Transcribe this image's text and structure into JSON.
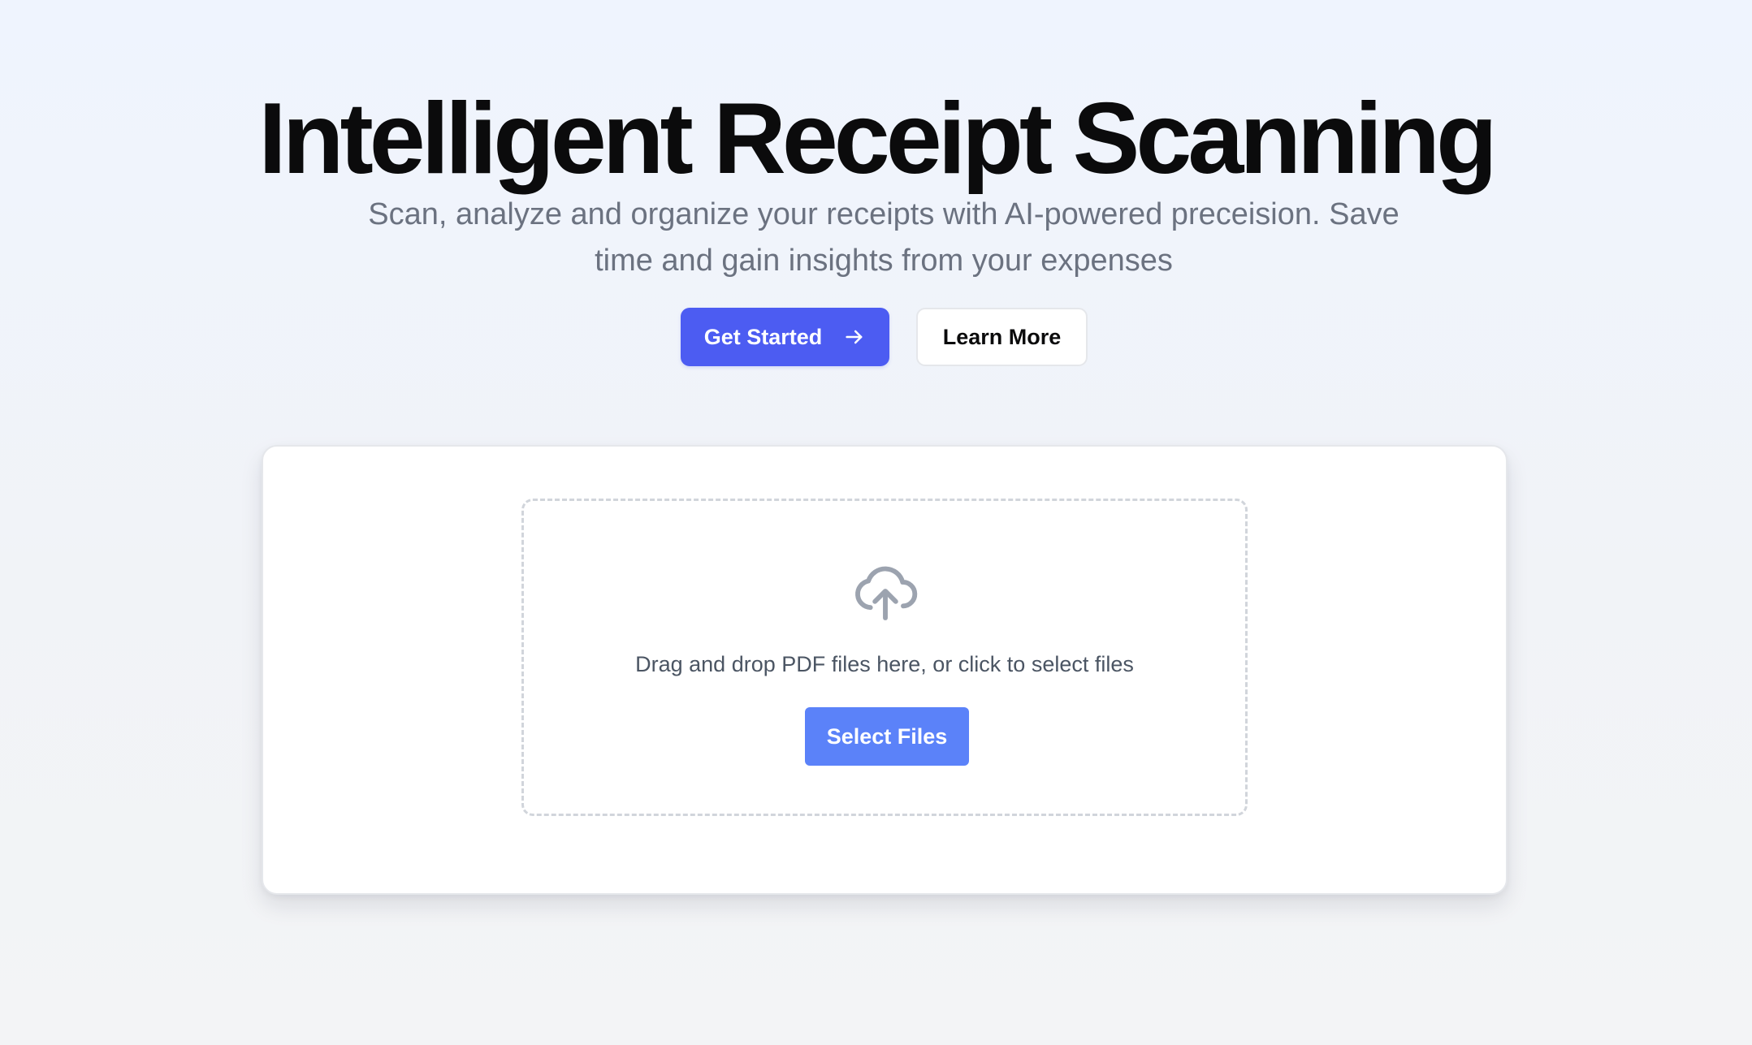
{
  "hero": {
    "title": "Intelligent Receipt Scanning",
    "subtitle": "Scan, analyze and organize your receipts with AI-powered preceision. Save time and gain insights from your expenses",
    "primary_button": {
      "label": "Get Started",
      "icon": "arrow-right-icon",
      "color": "#4c5cf2"
    },
    "secondary_button": {
      "label": "Learn More"
    }
  },
  "upload": {
    "icon": "cloud-upload-icon",
    "instruction": "Drag and drop PDF files here, or click to select files",
    "select_button": {
      "label": "Select Files",
      "color": "#5b82f9"
    }
  },
  "colors": {
    "accent": "#4c5cf2",
    "select_button": "#5b82f9",
    "title": "#0b0b0c",
    "subtitle": "#6b7280",
    "icon": "#9ca3af"
  }
}
